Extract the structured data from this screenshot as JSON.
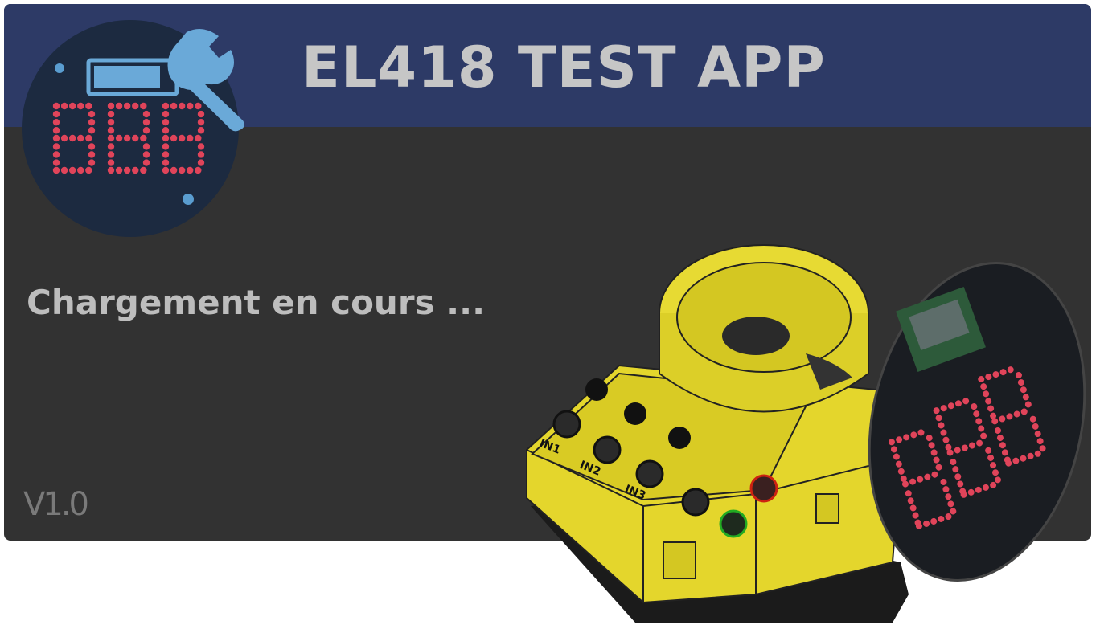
{
  "app": {
    "title": "EL418 TEST APP",
    "loading_text": "Chargement en cours ...",
    "version": "V1.0"
  },
  "device": {
    "inputs": [
      "IN1",
      "IN2",
      "IN3"
    ],
    "segment_display": "888"
  },
  "colors": {
    "header_bg": "#2d3a66",
    "body_bg": "#323232",
    "title_text": "#c6c6c6",
    "led_red": "#e0445a",
    "device_yellow": "#e4d62c",
    "pcb_dark": "#1a1d22"
  },
  "icons": {
    "logo": "segment-display-wrench-icon",
    "device": "test-fixture-device-image"
  }
}
